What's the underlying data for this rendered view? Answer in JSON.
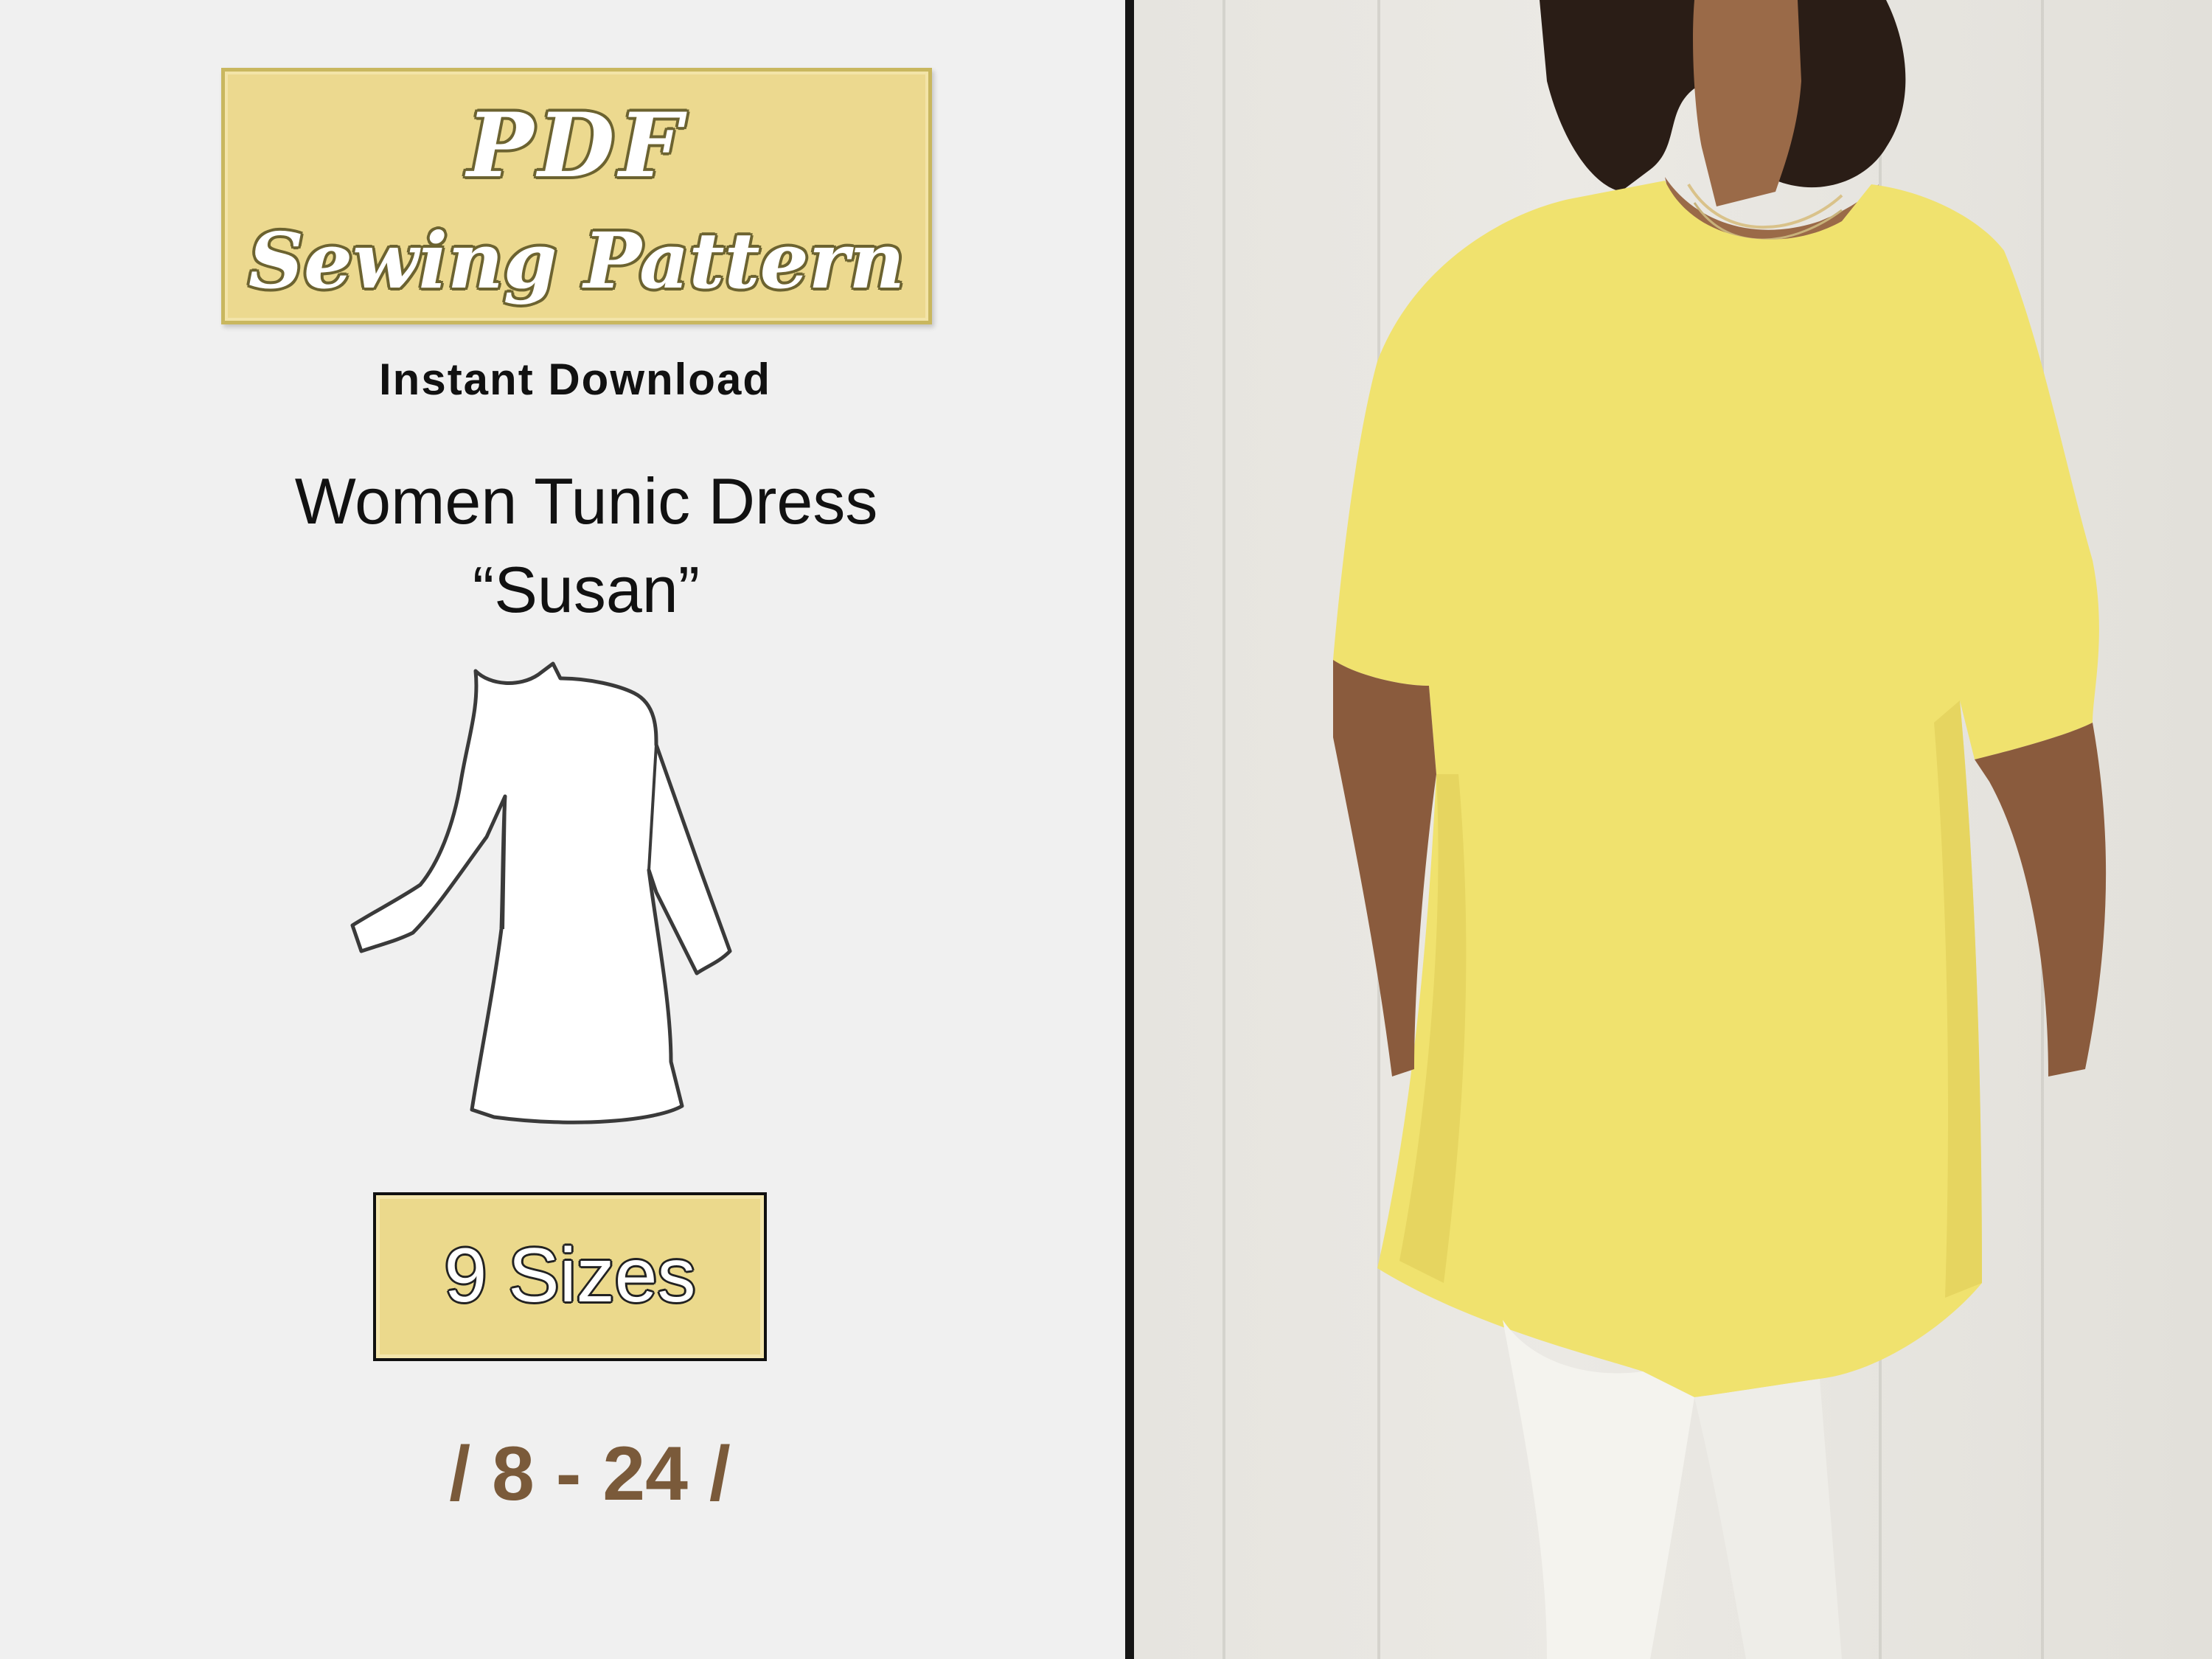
{
  "banner": {
    "pdf_label": "PDF",
    "title_label": "Sewing Pattern"
  },
  "instant_download": "Instant Download",
  "product": {
    "title": "Women Tunic Dress",
    "name": "“Susan”"
  },
  "sizes": {
    "count_label": "9 Sizes",
    "range_label": "/ 8 - 24 /"
  },
  "colors": {
    "banner_fill": "#ecd98f",
    "size_range_text": "#7a5a3a",
    "divider": "#151515",
    "tunic_yellow": "#f0e26e"
  },
  "icons": {
    "sketch": "tunic-dress-sketch-icon",
    "photo": "model-photo"
  }
}
